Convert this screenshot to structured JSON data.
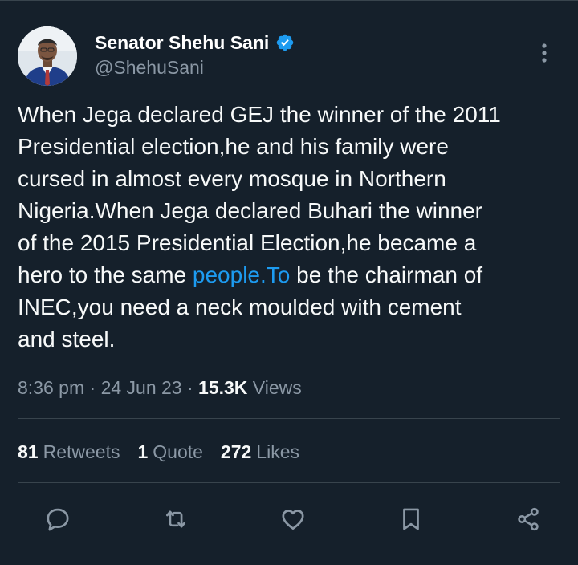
{
  "author": {
    "display_name": "Senator Shehu Sani",
    "handle": "@ShehuSani",
    "verified_icon": "verified-badge-icon",
    "verified_color": "#1d9bf0"
  },
  "tweet": {
    "text_before_link": "When Jega declared GEJ the winner of the 2011\nPresidential election,he and his family were\ncursed in almost every mosque in Northern\nNigeria.When Jega declared Buhari the winner\nof the 2015 Presidential Election,he became a\nhero to the same ",
    "link_text": "people.To",
    "text_after_link": " be the chairman of\nINEC,you need a neck moulded with cement\nand steel."
  },
  "meta": {
    "time": "8:36 pm",
    "sep1": " · ",
    "date": "24 Jun 23",
    "sep2": " · ",
    "views_count": "15.3K",
    "views_label": " Views"
  },
  "stats": {
    "retweets_count": "81",
    "retweets_label": "Retweets",
    "quotes_count": "1",
    "quotes_label": "Quote",
    "likes_count": "272",
    "likes_label": "Likes"
  },
  "actions": {
    "icons": [
      "reply-icon",
      "retweet-icon",
      "like-icon",
      "bookmark-icon",
      "share-icon"
    ],
    "icon_color": "#8b98a5"
  },
  "colors": {
    "background": "#15202b",
    "text": "#f7f9f9",
    "secondary": "#8b98a5",
    "link": "#1d9bf0",
    "divider": "#38444d"
  }
}
